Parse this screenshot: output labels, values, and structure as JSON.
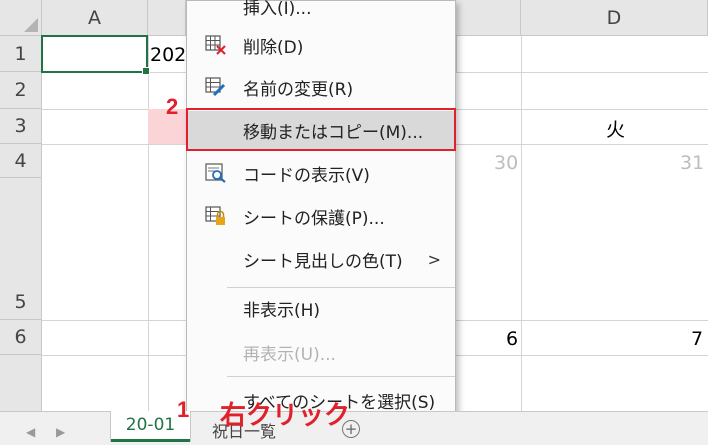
{
  "sheet": {
    "columns": [
      "A",
      "D"
    ],
    "rows": [
      "1",
      "2",
      "3",
      "4",
      "5",
      "6"
    ],
    "cell_b1_partial": "202",
    "d3_text": "火",
    "c4_number": "30",
    "d4_number": "31",
    "c6_number": "6",
    "d6_number": "7"
  },
  "context_menu": {
    "items": [
      {
        "label": "挿入(I)...",
        "icon": "insert-icon"
      },
      {
        "label": "削除(D)",
        "icon": "delete-sheet-icon"
      },
      {
        "label": "名前の変更(R)",
        "icon": "rename-icon"
      },
      {
        "label": "移動またはコピー(M)...",
        "icon": ""
      },
      {
        "label": "コードの表示(V)",
        "icon": "view-code-icon"
      },
      {
        "label": "シートの保護(P)...",
        "icon": "protect-sheet-icon"
      },
      {
        "label": "シート見出しの色(T)",
        "icon": ""
      },
      {
        "label": "非表示(H)",
        "icon": ""
      },
      {
        "label": "再表示(U)...",
        "icon": ""
      },
      {
        "label": "すべてのシートを選択(S)",
        "icon": ""
      }
    ],
    "submenu_arrow": ">"
  },
  "tabs": {
    "active": "20-01",
    "other_partial": "祝日一覧",
    "add_symbol": "+"
  },
  "annotations": {
    "step1_number": "1",
    "step1_text": "右クリック",
    "step2_number": "2"
  },
  "colors": {
    "accent": "#217346",
    "annotation_red": "#e0202a",
    "highlight_pink": "#fbd4d8"
  }
}
